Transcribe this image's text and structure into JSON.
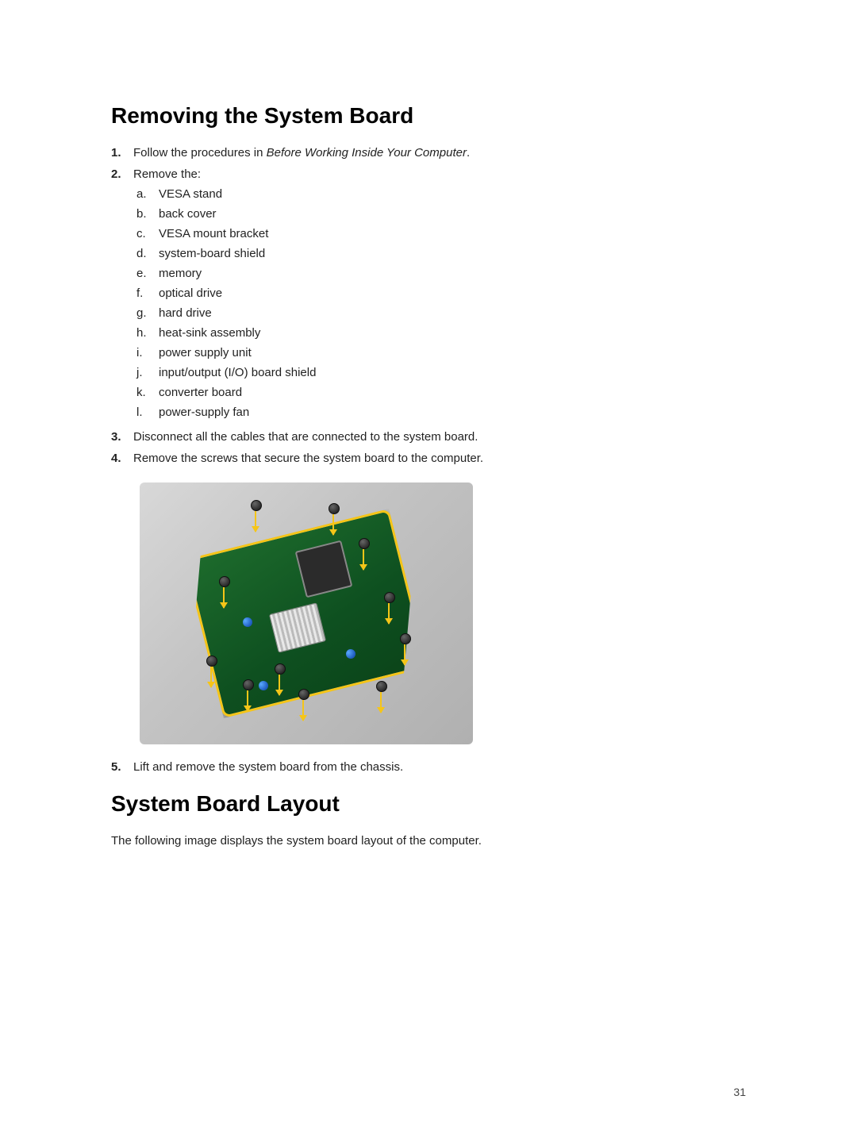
{
  "heading1": "Removing the System Board",
  "steps": {
    "s1_prefix": "Follow the procedures in ",
    "s1_italic": "Before Working Inside Your Computer",
    "s1_suffix": ".",
    "s2": "Remove the:",
    "sub": {
      "a": "VESA stand",
      "b": "back cover",
      "c": "VESA mount bracket",
      "d": "system-board shield",
      "e": "memory",
      "f": "optical drive",
      "g": "hard drive",
      "h": "heat-sink assembly",
      "i": "power supply unit",
      "j": "input/output (I/O) board shield",
      "k": "converter board",
      "l": "power-supply fan"
    },
    "s3": "Disconnect all the cables that are connected to the system board.",
    "s4": "Remove the screws that secure the system board to the computer.",
    "s5": "Lift and remove the system board from the chassis."
  },
  "heading2": "System Board Layout",
  "paragraph2": "The following image displays the system board layout of the computer.",
  "pageNumber": "31",
  "nums": {
    "n1": "1.",
    "n2": "2.",
    "n3": "3.",
    "n4": "4.",
    "n5": "5.",
    "la": "a.",
    "lb": "b.",
    "lc": "c.",
    "ld": "d.",
    "le": "e.",
    "lf": "f.",
    "lg": "g.",
    "lh": "h.",
    "li": "i.",
    "lj": "j.",
    "lk": "k.",
    "ll": "l."
  }
}
